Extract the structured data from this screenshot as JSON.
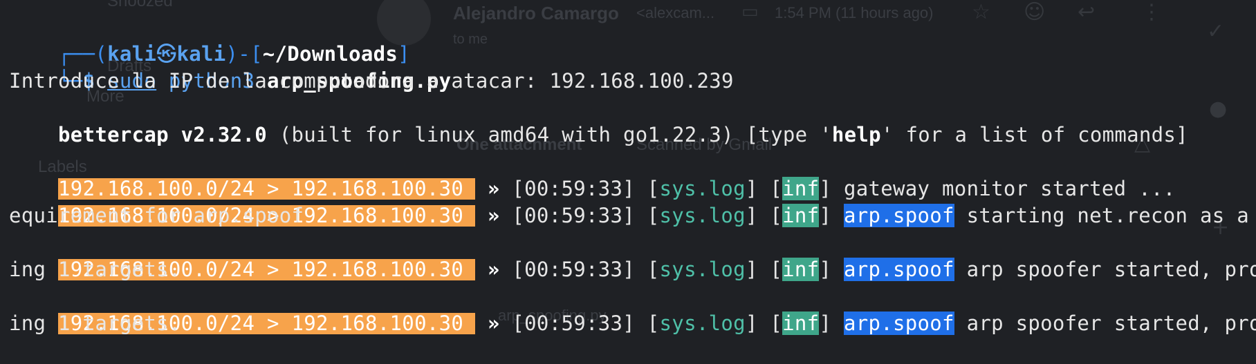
{
  "background_app": {
    "sender_name": "Alejandro Camargo",
    "sender_email": "<alexcam...",
    "time": "1:54 PM (11 hours ago)",
    "to": "to me",
    "sidebar_snoozed": "Snoozed",
    "sidebar_drafts": "Drafts",
    "sidebar_more": "More",
    "sidebar_labels": "Labels",
    "attachment_header": "One attachment",
    "scanned": "Scanned by Gmail",
    "attachment_name": "arp_spoofing.py"
  },
  "terminal": {
    "prompt": {
      "corner_top": "┌──(",
      "user": "kali",
      "at": "㉿",
      "host": "kali",
      "mid": ")-[",
      "path": "~/Downloads",
      "end": "]",
      "corner_bottom": "└─",
      "dollar": "$",
      "sudo": "sudo",
      "python": "python3",
      "script": "arp_spoofing.py"
    },
    "input_line": "Introduce la IP de la computadora a atacar: 192.168.100.239",
    "bettercap": {
      "name": "bettercap v2.32.0",
      "build": " (built for linux amd64 with go1.22.3) [type '",
      "help": "help",
      "rest": "' for a list of commands]"
    },
    "log_lines": [
      {
        "subnet": "192.168.100.0/24 > 192.168.100.30",
        "sep": "»",
        "time": "[00:59:33]",
        "source": "sys.log",
        "level": "inf",
        "module": "",
        "message": "gateway monitor started ...",
        "wrap": ""
      },
      {
        "subnet": "192.168.100.0/24 > 192.168.100.30",
        "sep": "»",
        "time": "[00:59:33]",
        "source": "sys.log",
        "level": "inf",
        "module": "arp.spoof",
        "message": "starting net.recon as a r",
        "wrap": "equirement for arp.spoof"
      },
      {
        "subnet": "192.168.100.0/24 > 192.168.100.30",
        "sep": "»",
        "time": "[00:59:33]",
        "source": "sys.log",
        "level": "inf",
        "module": "arp.spoof",
        "message": "arp spoofer started, prob",
        "wrap": "ing 1 targets."
      },
      {
        "subnet": "192.168.100.0/24 > 192.168.100.30",
        "sep": "»",
        "time": "[00:59:33]",
        "source": "sys.log",
        "level": "inf",
        "module": "arp.spoof",
        "message": "arp spoofer started, prob",
        "wrap": "ing 1 targets."
      }
    ]
  },
  "colors": {
    "background": "#1f2125",
    "prompt_blue": "#3b8ef0",
    "subnet_orange": "#f7a34b",
    "inf_teal": "#3fa68a",
    "module_blue": "#1f6fe8",
    "syslog_teal": "#4fc0a8"
  }
}
